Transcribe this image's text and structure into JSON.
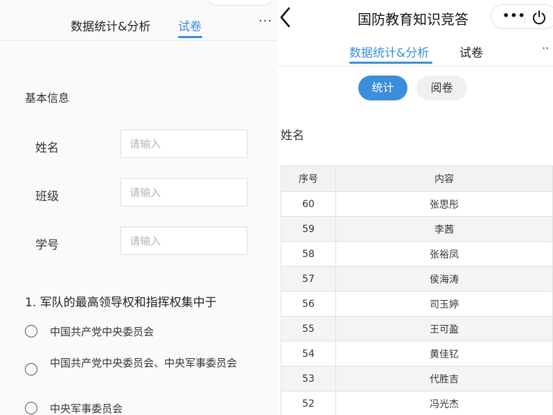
{
  "left": {
    "tabs": [
      {
        "label": "数据统计&分析"
      },
      {
        "label": "试卷"
      }
    ],
    "more_label": "···",
    "section_title": "基本信息",
    "fields": [
      {
        "label": "姓名",
        "placeholder": "请输入"
      },
      {
        "label": "班级",
        "placeholder": "请输入"
      },
      {
        "label": "学号",
        "placeholder": "请输入"
      }
    ],
    "question": {
      "text": "1. 军队的最高领导权和指挥权集中于",
      "options": [
        {
          "label": "中国共产党中央委员会"
        },
        {
          "label": "中国共产党中央委员会、中央军事委员会"
        },
        {
          "label": "中央军事委员会"
        }
      ]
    }
  },
  "right": {
    "title": "国防教育知识竞答",
    "capsule_more": "•••",
    "tabs": [
      {
        "label": "数据统计&分析"
      },
      {
        "label": "试卷"
      }
    ],
    "more_label": "··",
    "pills": [
      {
        "label": "统计"
      },
      {
        "label": "阅卷"
      }
    ],
    "filter_label": "姓名",
    "table": {
      "headers": [
        "序号",
        "内容"
      ],
      "rows": [
        [
          "60",
          "张思彤"
        ],
        [
          "59",
          "李茜"
        ],
        [
          "58",
          "张裕凤"
        ],
        [
          "57",
          "侯海涛"
        ],
        [
          "56",
          "司玉婷"
        ],
        [
          "55",
          "王可盈"
        ],
        [
          "54",
          "黄佳钇"
        ],
        [
          "53",
          "代胜吉"
        ],
        [
          "52",
          "冯光杰"
        ]
      ]
    }
  },
  "colors": {
    "accent": "#3c8ddb",
    "header_bg": "#f2f2f2",
    "stripe_bg": "#f4f4f4"
  },
  "icons": {
    "back": "chevron-left-icon",
    "power": "power-icon",
    "more": "more-dots-icon",
    "radio": "radio-unchecked-icon"
  }
}
